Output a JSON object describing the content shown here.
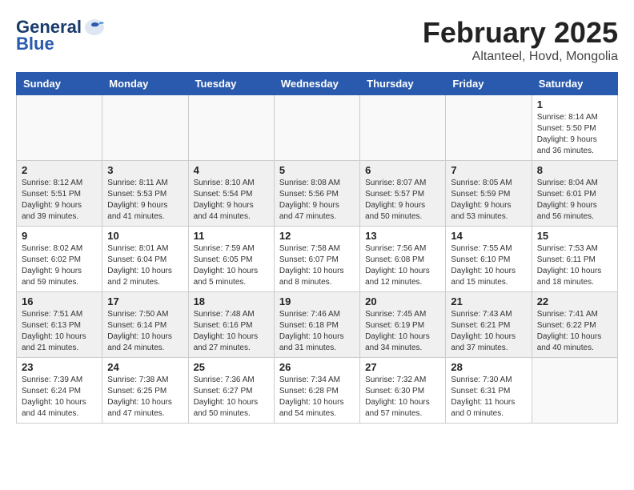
{
  "header": {
    "logo_line1": "General",
    "logo_line2": "Blue",
    "month": "February 2025",
    "location": "Altanteel, Hovd, Mongolia"
  },
  "weekdays": [
    "Sunday",
    "Monday",
    "Tuesday",
    "Wednesday",
    "Thursday",
    "Friday",
    "Saturday"
  ],
  "weeks": [
    [
      {
        "day": "",
        "info": ""
      },
      {
        "day": "",
        "info": ""
      },
      {
        "day": "",
        "info": ""
      },
      {
        "day": "",
        "info": ""
      },
      {
        "day": "",
        "info": ""
      },
      {
        "day": "",
        "info": ""
      },
      {
        "day": "1",
        "info": "Sunrise: 8:14 AM\nSunset: 5:50 PM\nDaylight: 9 hours\nand 36 minutes."
      }
    ],
    [
      {
        "day": "2",
        "info": "Sunrise: 8:12 AM\nSunset: 5:51 PM\nDaylight: 9 hours\nand 39 minutes."
      },
      {
        "day": "3",
        "info": "Sunrise: 8:11 AM\nSunset: 5:53 PM\nDaylight: 9 hours\nand 41 minutes."
      },
      {
        "day": "4",
        "info": "Sunrise: 8:10 AM\nSunset: 5:54 PM\nDaylight: 9 hours\nand 44 minutes."
      },
      {
        "day": "5",
        "info": "Sunrise: 8:08 AM\nSunset: 5:56 PM\nDaylight: 9 hours\nand 47 minutes."
      },
      {
        "day": "6",
        "info": "Sunrise: 8:07 AM\nSunset: 5:57 PM\nDaylight: 9 hours\nand 50 minutes."
      },
      {
        "day": "7",
        "info": "Sunrise: 8:05 AM\nSunset: 5:59 PM\nDaylight: 9 hours\nand 53 minutes."
      },
      {
        "day": "8",
        "info": "Sunrise: 8:04 AM\nSunset: 6:01 PM\nDaylight: 9 hours\nand 56 minutes."
      }
    ],
    [
      {
        "day": "9",
        "info": "Sunrise: 8:02 AM\nSunset: 6:02 PM\nDaylight: 9 hours\nand 59 minutes."
      },
      {
        "day": "10",
        "info": "Sunrise: 8:01 AM\nSunset: 6:04 PM\nDaylight: 10 hours\nand 2 minutes."
      },
      {
        "day": "11",
        "info": "Sunrise: 7:59 AM\nSunset: 6:05 PM\nDaylight: 10 hours\nand 5 minutes."
      },
      {
        "day": "12",
        "info": "Sunrise: 7:58 AM\nSunset: 6:07 PM\nDaylight: 10 hours\nand 8 minutes."
      },
      {
        "day": "13",
        "info": "Sunrise: 7:56 AM\nSunset: 6:08 PM\nDaylight: 10 hours\nand 12 minutes."
      },
      {
        "day": "14",
        "info": "Sunrise: 7:55 AM\nSunset: 6:10 PM\nDaylight: 10 hours\nand 15 minutes."
      },
      {
        "day": "15",
        "info": "Sunrise: 7:53 AM\nSunset: 6:11 PM\nDaylight: 10 hours\nand 18 minutes."
      }
    ],
    [
      {
        "day": "16",
        "info": "Sunrise: 7:51 AM\nSunset: 6:13 PM\nDaylight: 10 hours\nand 21 minutes."
      },
      {
        "day": "17",
        "info": "Sunrise: 7:50 AM\nSunset: 6:14 PM\nDaylight: 10 hours\nand 24 minutes."
      },
      {
        "day": "18",
        "info": "Sunrise: 7:48 AM\nSunset: 6:16 PM\nDaylight: 10 hours\nand 27 minutes."
      },
      {
        "day": "19",
        "info": "Sunrise: 7:46 AM\nSunset: 6:18 PM\nDaylight: 10 hours\nand 31 minutes."
      },
      {
        "day": "20",
        "info": "Sunrise: 7:45 AM\nSunset: 6:19 PM\nDaylight: 10 hours\nand 34 minutes."
      },
      {
        "day": "21",
        "info": "Sunrise: 7:43 AM\nSunset: 6:21 PM\nDaylight: 10 hours\nand 37 minutes."
      },
      {
        "day": "22",
        "info": "Sunrise: 7:41 AM\nSunset: 6:22 PM\nDaylight: 10 hours\nand 40 minutes."
      }
    ],
    [
      {
        "day": "23",
        "info": "Sunrise: 7:39 AM\nSunset: 6:24 PM\nDaylight: 10 hours\nand 44 minutes."
      },
      {
        "day": "24",
        "info": "Sunrise: 7:38 AM\nSunset: 6:25 PM\nDaylight: 10 hours\nand 47 minutes."
      },
      {
        "day": "25",
        "info": "Sunrise: 7:36 AM\nSunset: 6:27 PM\nDaylight: 10 hours\nand 50 minutes."
      },
      {
        "day": "26",
        "info": "Sunrise: 7:34 AM\nSunset: 6:28 PM\nDaylight: 10 hours\nand 54 minutes."
      },
      {
        "day": "27",
        "info": "Sunrise: 7:32 AM\nSunset: 6:30 PM\nDaylight: 10 hours\nand 57 minutes."
      },
      {
        "day": "28",
        "info": "Sunrise: 7:30 AM\nSunset: 6:31 PM\nDaylight: 11 hours\nand 0 minutes."
      },
      {
        "day": "",
        "info": ""
      }
    ]
  ]
}
